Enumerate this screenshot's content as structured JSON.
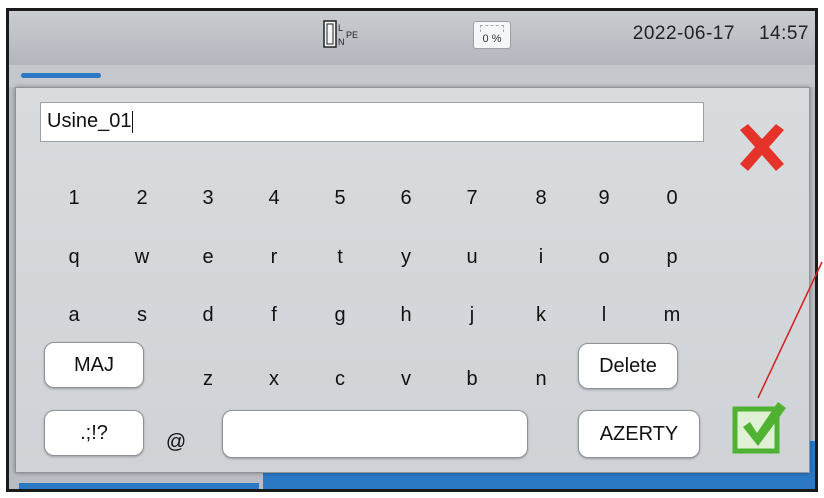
{
  "status_bar": {
    "connection_icon": "terminal-L-N-PE-icon",
    "connection_labels": {
      "l": "L",
      "n": "N",
      "pe": "PE"
    },
    "battery_icon": "battery-icon",
    "battery_percent": "0 %",
    "date": "2022-06-17",
    "time": "14:57"
  },
  "keyboard": {
    "text_value": "Usine_01",
    "rows": [
      [
        "1",
        "2",
        "3",
        "4",
        "5",
        "6",
        "7",
        "8",
        "9",
        "0"
      ],
      [
        "q",
        "w",
        "e",
        "r",
        "t",
        "y",
        "u",
        "i",
        "o",
        "p"
      ],
      [
        "a",
        "s",
        "d",
        "f",
        "g",
        "h",
        "j",
        "k",
        "l",
        "m"
      ],
      [
        "z",
        "x",
        "c",
        "v",
        "b",
        "n"
      ]
    ],
    "shift_label": "MAJ",
    "delete_label": "Delete",
    "symbols_label": ".;!?",
    "at_label": "@",
    "layout_label": "AZERTY",
    "space_value": "",
    "cancel_icon": "cancel-x-icon",
    "confirm_icon": "confirm-check-icon"
  },
  "colors": {
    "accent_blue": "#2b78c5",
    "cancel_red": "#e5332a",
    "confirm_green": "#4fb233",
    "annotation_red": "#d42020"
  }
}
